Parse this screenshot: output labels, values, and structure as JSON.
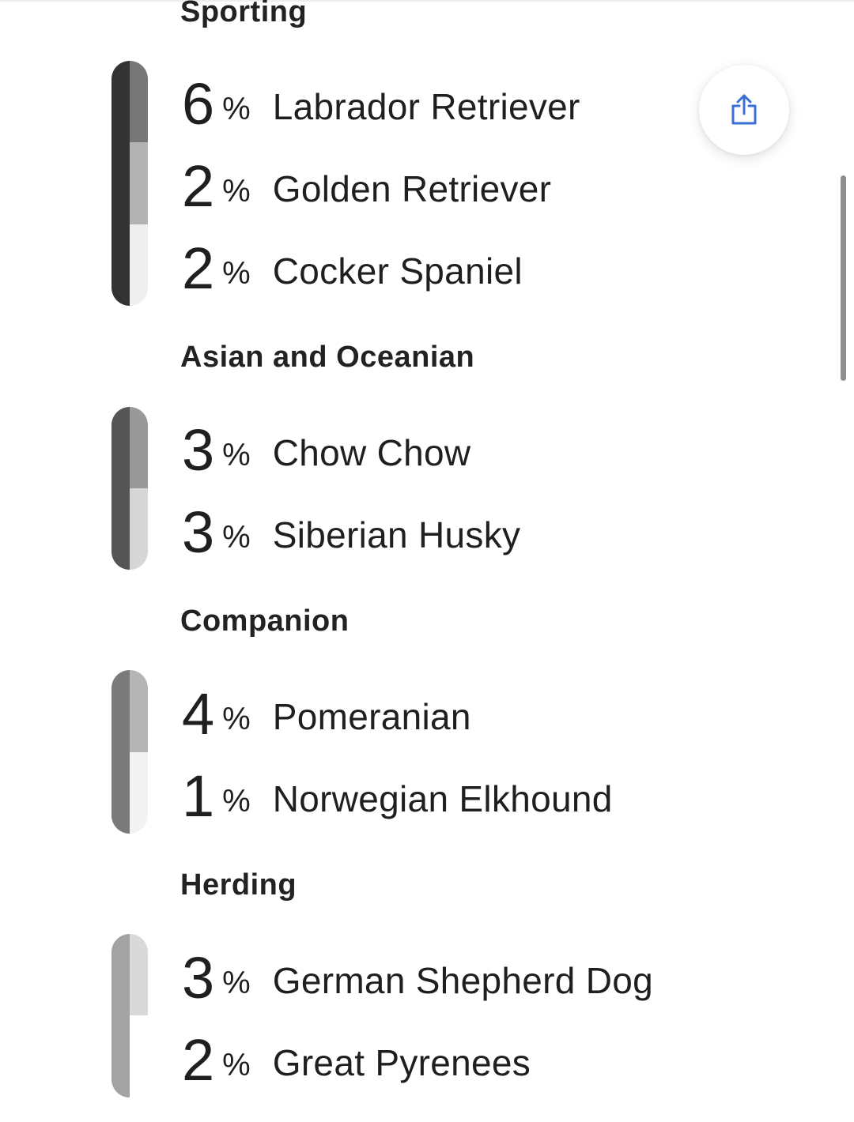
{
  "share": {
    "icon": "share-icon",
    "color": "#3a6fd8"
  },
  "groups": [
    {
      "title": "Sporting",
      "bar_color": "#333333",
      "breeds": [
        {
          "percent": "6",
          "sign": "%",
          "name": "Labrador Retriever",
          "segment_color": "#777777"
        },
        {
          "percent": "2",
          "sign": "%",
          "name": "Golden Retriever",
          "segment_color": "#b3b3b3"
        },
        {
          "percent": "2",
          "sign": "%",
          "name": "Cocker Spaniel",
          "segment_color": "#efefef"
        }
      ]
    },
    {
      "title": "Asian and Oceanian",
      "bar_color": "#555555",
      "breeds": [
        {
          "percent": "3",
          "sign": "%",
          "name": "Chow Chow",
          "segment_color": "#999999"
        },
        {
          "percent": "3",
          "sign": "%",
          "name": "Siberian Husky",
          "segment_color": "#d6d6d6"
        }
      ]
    },
    {
      "title": "Companion",
      "bar_color": "#7a7a7a",
      "breeds": [
        {
          "percent": "4",
          "sign": "%",
          "name": "Pomeranian",
          "segment_color": "#b5b5b5"
        },
        {
          "percent": "1",
          "sign": "%",
          "name": "Norwegian Elkhound",
          "segment_color": "#f3f3f3"
        }
      ]
    },
    {
      "title": "Herding",
      "bar_color": "#a3a3a3",
      "breeds": [
        {
          "percent": "3",
          "sign": "%",
          "name": "German Shepherd Dog",
          "segment_color": "#d9d9d9"
        },
        {
          "percent": "2",
          "sign": "%",
          "name": "Great Pyrenees",
          "segment_color": "#ffffff"
        }
      ]
    }
  ]
}
